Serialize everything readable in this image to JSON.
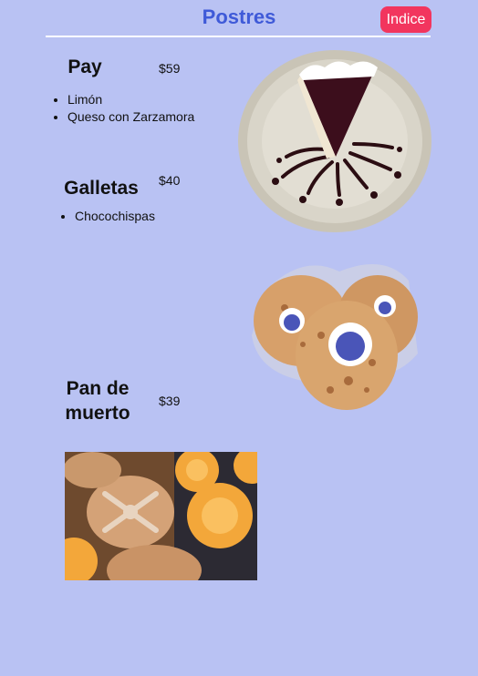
{
  "header": {
    "title": "Postres",
    "index_label": "Indice"
  },
  "products": [
    {
      "name": "Pay",
      "price": "$59",
      "options": [
        "Limón",
        "Queso con Zarzamora"
      ],
      "image": "cheesecake-photo"
    },
    {
      "name": "Galletas",
      "price": "$40",
      "options": [
        "Chocochispas"
      ],
      "image": "cookies-photo"
    },
    {
      "name": "Pan de muerto",
      "price": "$39",
      "options": [],
      "image": "pan-de-muerto-photo"
    }
  ],
  "colors": {
    "background": "#b9c2f3",
    "title": "#3f5ad8",
    "index_button": "#f2355e"
  }
}
